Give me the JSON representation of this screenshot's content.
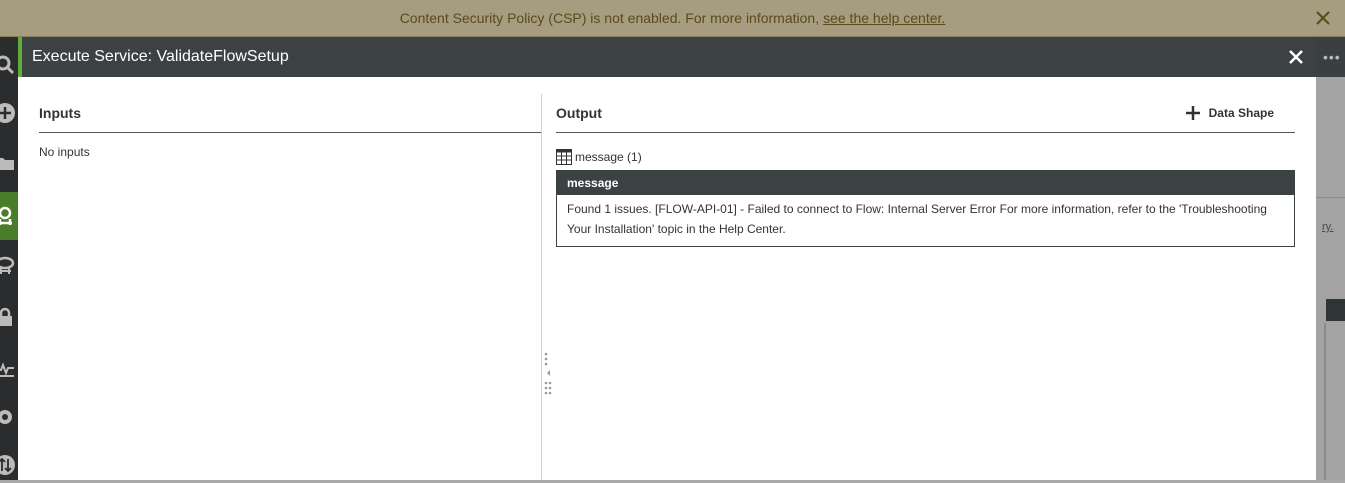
{
  "banner": {
    "message": "Content Security Policy (CSP) is not enabled. For more information,",
    "link_text": "see the help center."
  },
  "modal": {
    "title": "Execute Service: ValidateFlowSetup"
  },
  "inputs": {
    "heading": "Inputs",
    "empty_text": "No inputs"
  },
  "output": {
    "heading": "Output",
    "data_shape_label": "Data Shape",
    "result_label": "message (1)",
    "table": {
      "columns": [
        "message"
      ],
      "rows": [
        [
          "Found 1 issues. [FLOW-API-01] - Failed to connect to Flow: Internal Server Error For more information, refer to the 'Troubleshooting Your Installation' topic in the Help Center."
        ]
      ]
    }
  },
  "background": {
    "overflow_icon": "more-horizontal-icon",
    "link_fragment": "ry."
  },
  "colors": {
    "banner_bg": "#a69c7f",
    "modal_header_bg": "#3c4244",
    "accent_green": "#5fae3a",
    "table_header_bg": "#3c4244"
  }
}
